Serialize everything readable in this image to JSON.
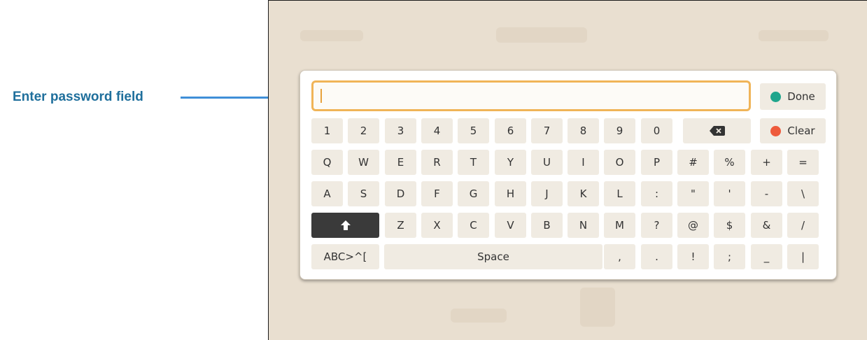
{
  "callout": {
    "label": "Enter password field"
  },
  "input": {
    "value": ""
  },
  "colors": {
    "done": "#1fa58c",
    "clear": "#ee5a3b",
    "accent": "#f0b458",
    "callout": "#3f8fd8"
  },
  "actions": {
    "done": "Done",
    "clear": "Clear"
  },
  "rows": {
    "r0": [
      "1",
      "2",
      "3",
      "4",
      "5",
      "6",
      "7",
      "8",
      "9",
      "0"
    ],
    "r1": [
      "Q",
      "W",
      "E",
      "R",
      "T",
      "Y",
      "U",
      "I",
      "O",
      "P",
      "#",
      "%",
      "+",
      "="
    ],
    "r2": [
      "A",
      "S",
      "D",
      "F",
      "G",
      "H",
      "J",
      "K",
      "L",
      ":",
      "\"",
      "'",
      "-",
      "\\"
    ],
    "r3": [
      "Z",
      "X",
      "C",
      "V",
      "B",
      "N",
      "M",
      "?",
      "@",
      "$",
      "&",
      "/"
    ],
    "r4_mode": "ABC>^[",
    "r4_space": "Space",
    "r4": [
      ",",
      ".",
      "!",
      ";",
      "_",
      "|"
    ]
  },
  "icons": {
    "backspace": "backspace-icon",
    "shift": "shift-up-arrow-icon"
  }
}
